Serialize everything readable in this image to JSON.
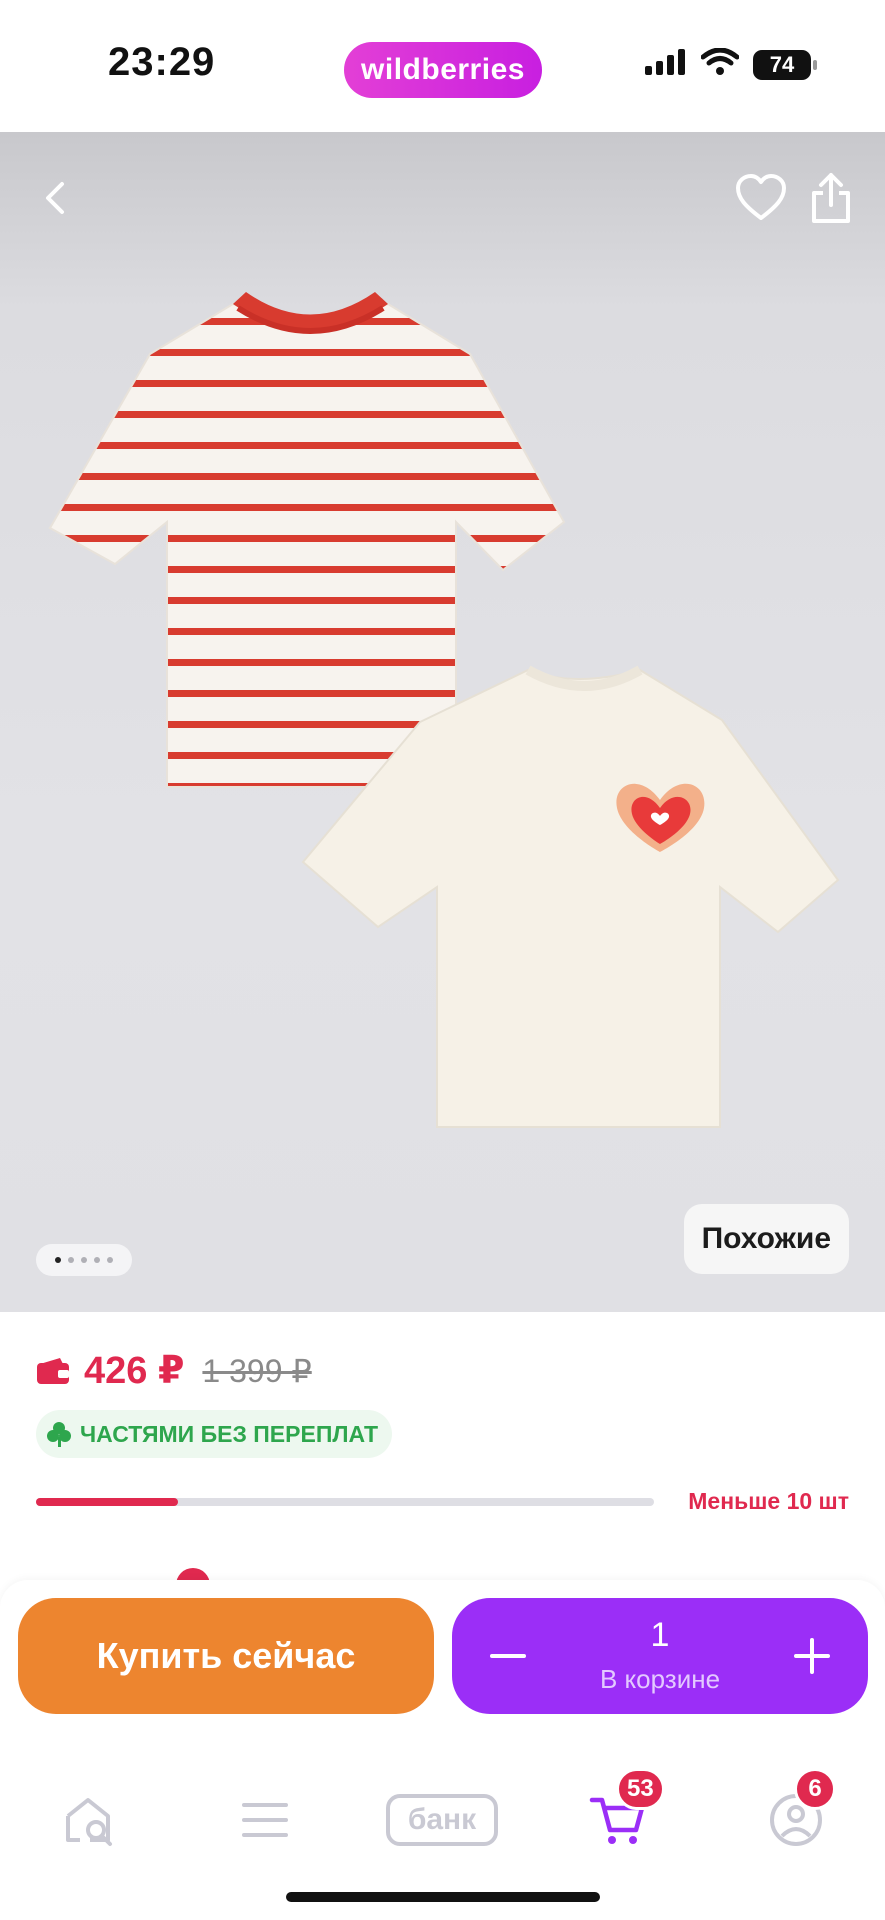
{
  "status_bar": {
    "time": "23:29",
    "brand": "wildberries",
    "battery": "74",
    "icons": [
      "signal-icon",
      "wifi-icon",
      "battery-icon"
    ]
  },
  "gallery": {
    "similar_label": "Похожие",
    "image_count": 5,
    "active_index": 0,
    "icons": [
      "back-icon",
      "heart-icon",
      "share-icon"
    ]
  },
  "product": {
    "price": "426 ₽",
    "old_price": "1 399 ₽",
    "installments": "ЧАСТЯМИ БЕЗ ПЕРЕПЛАТ",
    "stock_text": "Меньше 10 шт",
    "stock_fraction": 0.23
  },
  "actions": {
    "buy_now": "Купить сейчас",
    "quantity": "1",
    "in_cart": "В корзине"
  },
  "tab_bar": {
    "bank_label": "банк",
    "cart_badge": "53",
    "profile_badge": "6"
  },
  "colors": {
    "accent_price": "#e0294f",
    "buy_button": "#ed852f",
    "cart_button": "#9b2ef7",
    "brand": "#cf2be0",
    "installments": "#2ea64d"
  }
}
